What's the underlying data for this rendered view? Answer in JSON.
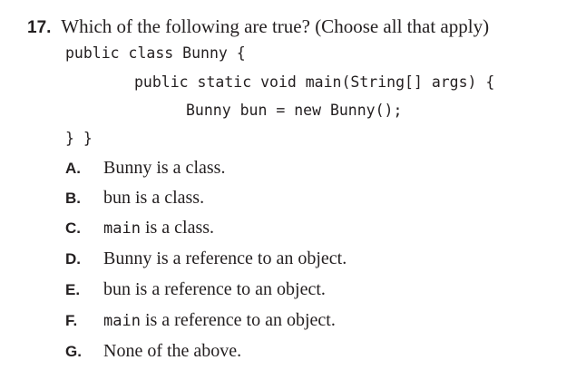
{
  "question": {
    "number": "17.",
    "text": "Which of the following are true? (Choose all that apply)"
  },
  "code": {
    "line1": "public class Bunny {",
    "line2": "public static void main(String[] args) {",
    "line3": "Bunny bun = new Bunny();",
    "line4": "} }"
  },
  "options": [
    {
      "letter": "A.",
      "subject": "Bunny",
      "rest": " is a class."
    },
    {
      "letter": "B.",
      "subject": "bun",
      "rest": " is a class."
    },
    {
      "letter": "C.",
      "subject": "main",
      "rest": " is a class."
    },
    {
      "letter": "D.",
      "subject": "Bunny",
      "rest": " is a reference to an object."
    },
    {
      "letter": "E.",
      "subject": "bun",
      "rest": " is a reference to an object."
    },
    {
      "letter": "F.",
      "subject": "main",
      "rest": " is a reference to an object."
    },
    {
      "letter": "G.",
      "subject": "",
      "rest": "None of the above."
    }
  ]
}
